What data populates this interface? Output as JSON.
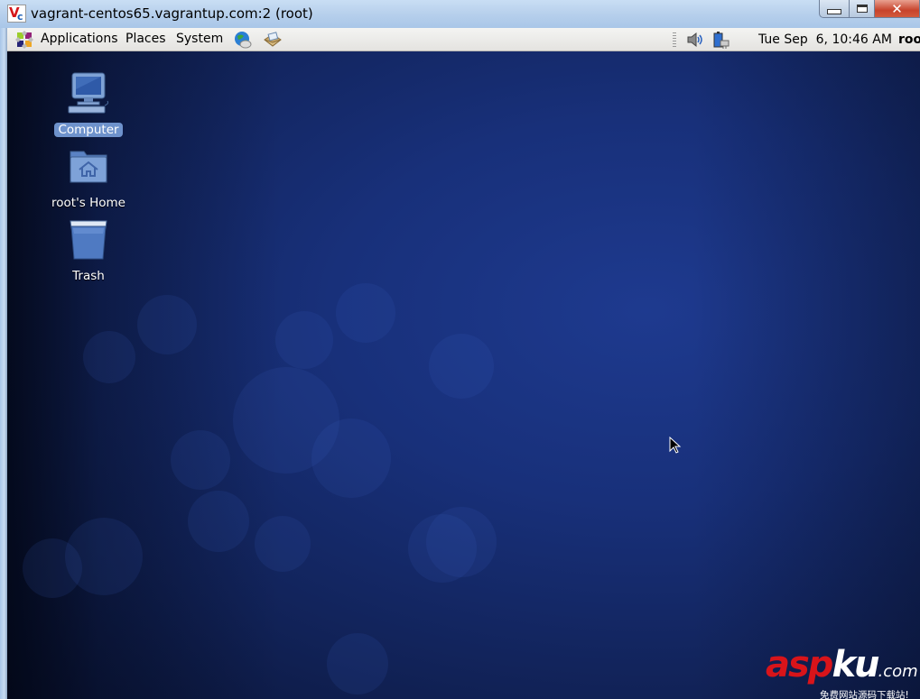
{
  "window": {
    "title": "vagrant-centos65.vagrantup.com:2 (root)",
    "app_icon": "vnc-icon",
    "controls": {
      "minimize": "minimize",
      "maximize": "maximize",
      "close": "close"
    }
  },
  "panel": {
    "menus": [
      {
        "label": "Applications",
        "icon": "centos-logo-icon"
      },
      {
        "label": "Places"
      },
      {
        "label": "System"
      }
    ],
    "launchers": [
      {
        "name": "web-browser",
        "icon": "globe-mail-icon"
      },
      {
        "name": "email-client",
        "icon": "envelope-icon"
      }
    ],
    "tray": [
      {
        "name": "volume",
        "icon": "speaker-icon"
      },
      {
        "name": "power",
        "icon": "battery-plug-icon"
      }
    ],
    "clock": "Tue Sep  6, 10:46 AM",
    "user": "root"
  },
  "desktop": {
    "icons": [
      {
        "label": "Computer",
        "icon": "computer-icon",
        "selected": true
      },
      {
        "label": "root's Home",
        "icon": "home-folder-icon",
        "selected": false
      },
      {
        "label": "Trash",
        "icon": "trash-icon",
        "selected": false
      }
    ],
    "accent_color": "#6e92cc"
  },
  "watermark": {
    "red": "asp",
    "white": "ku",
    "suffix": ".com",
    "tagline": "免费网站源码下载站!"
  }
}
